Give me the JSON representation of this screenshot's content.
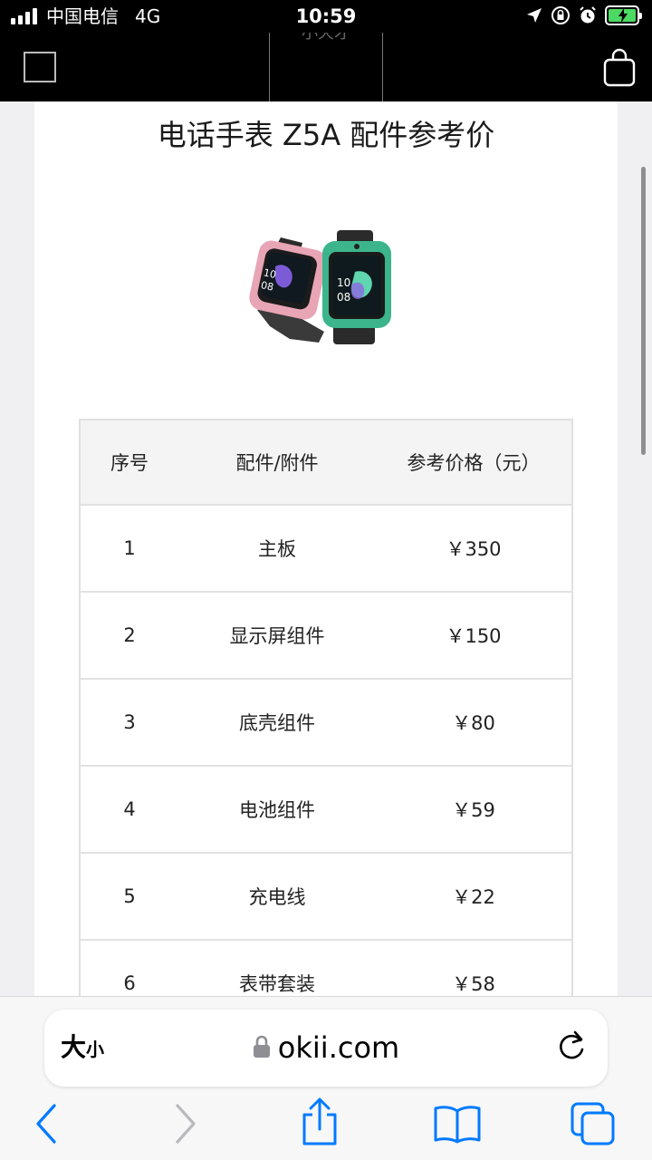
{
  "status_bar": {
    "carrier": "中国电信",
    "network": "4G",
    "time": "10:59",
    "icons": [
      "signal-icon",
      "location-arrow-icon",
      "orientation-lock-icon",
      "alarm-icon",
      "battery-charging-icon"
    ],
    "battery_color": "#4cd964"
  },
  "site_header": {
    "logo_text": "小天才",
    "icons": [
      "menu-icon",
      "shopping-bag-icon"
    ]
  },
  "page": {
    "title": "电话手表 Z5A 配件参考价",
    "product_image": "smartwatch-product-image"
  },
  "table": {
    "headers": [
      "序号",
      "配件/附件",
      "参考价格（元）"
    ],
    "rows": [
      {
        "index": "1",
        "part": "主板",
        "price": "￥350"
      },
      {
        "index": "2",
        "part": "显示屏组件",
        "price": "￥150"
      },
      {
        "index": "3",
        "part": "底壳组件",
        "price": "￥80"
      },
      {
        "index": "4",
        "part": "电池组件",
        "price": "￥59"
      },
      {
        "index": "5",
        "part": "充电线",
        "price": "￥22"
      },
      {
        "index": "6",
        "part": "表带套装",
        "price": "￥58"
      }
    ]
  },
  "browser": {
    "text_size_big": "大",
    "text_size_small": "小",
    "url": "okii.com",
    "accent_color": "#007aff",
    "toolbar_icons": [
      "back-icon",
      "forward-icon",
      "share-icon",
      "bookmarks-icon",
      "tabs-icon"
    ]
  }
}
